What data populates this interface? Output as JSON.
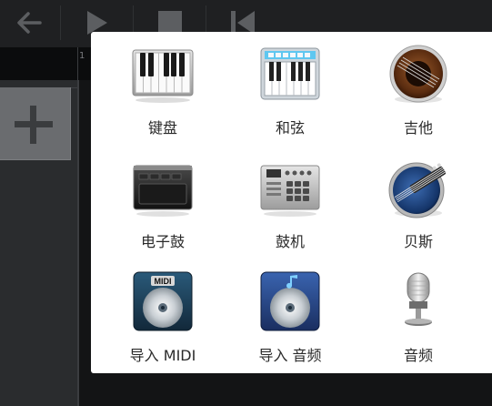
{
  "instruments": [
    {
      "label": "键盘",
      "icon": "piano-keyboard-icon"
    },
    {
      "label": "和弦",
      "icon": "chord-keyboard-icon"
    },
    {
      "label": "吉他",
      "icon": "guitar-icon"
    },
    {
      "label": "电子鼓",
      "icon": "drum-pad-icon"
    },
    {
      "label": "鼓机",
      "icon": "drum-machine-icon"
    },
    {
      "label": "贝斯",
      "icon": "bass-icon"
    },
    {
      "label": "导入 MIDI",
      "icon": "midi-disc-icon"
    },
    {
      "label": "导入 音频",
      "icon": "audio-disc-icon"
    },
    {
      "label": "音频",
      "icon": "microphone-icon"
    }
  ],
  "toolbar": {
    "icons": [
      "back-arrow-icon",
      "play-icon",
      "stop-icon",
      "skip-to-start-icon"
    ]
  },
  "timeline": {
    "ruler_start": "1"
  },
  "colors": {
    "popup_bg": "#ffffff",
    "app_bg": "#17191b",
    "label_text": "#2a2a2a"
  }
}
